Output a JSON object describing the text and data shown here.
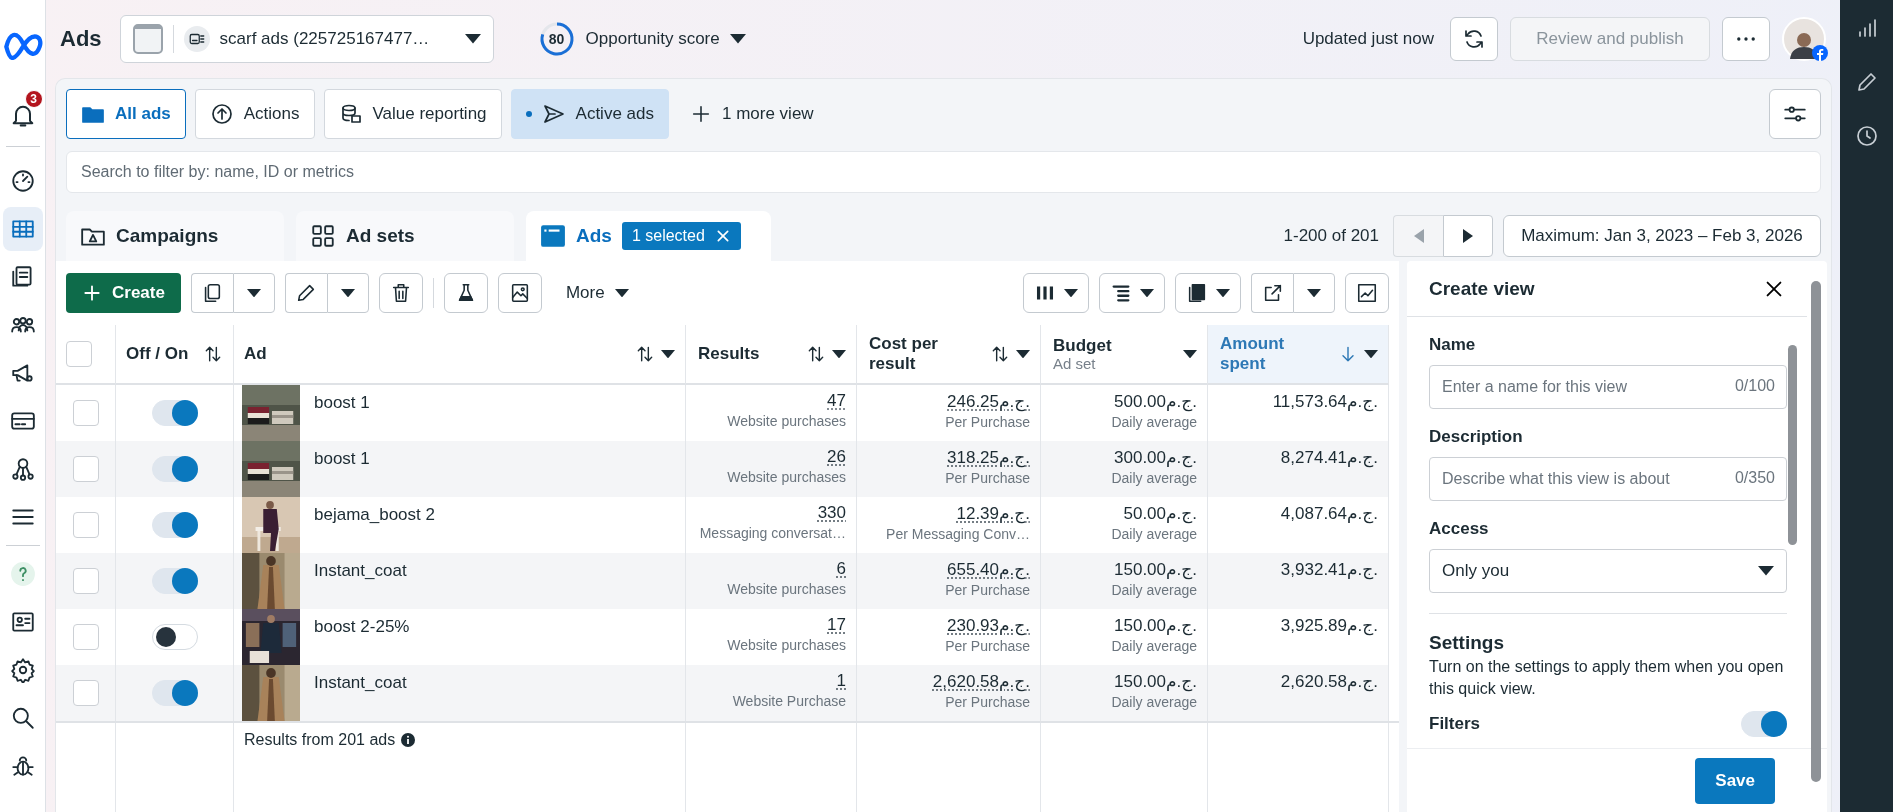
{
  "header": {
    "title": "Ads",
    "account": "scarf ads (225725167477…",
    "score": {
      "value": "80"
    },
    "score_label": "Opportunity score",
    "updated": "Updated just now",
    "review_button": {
      "label": "Review and publish",
      "disabled": true
    }
  },
  "notifications": "3",
  "nav_items": [
    {
      "selected": false
    },
    {
      "selected": true
    },
    {
      "selected": false
    },
    {
      "selected": false
    },
    {
      "selected": false
    },
    {
      "selected": false
    },
    {
      "selected": false
    },
    {
      "selected": false
    },
    {
      "selected": false
    },
    {
      "selected": false
    },
    {
      "selected": false
    },
    {
      "selected": false
    },
    {
      "selected": false
    }
  ],
  "views": [
    {
      "label": "All ads",
      "selected": true,
      "has_changes": false
    },
    {
      "label": "Actions",
      "selected": false,
      "has_changes": false
    },
    {
      "label": "Value reporting",
      "selected": false,
      "has_changes": false
    },
    {
      "label": "Active ads",
      "selected": false,
      "has_changes": true
    }
  ],
  "more_views": "1 more view",
  "search": {
    "placeholder": "Search to filter by: name, ID or metrics"
  },
  "level_tabs": [
    {
      "label": "Campaigns",
      "selected": false
    },
    {
      "label": "Ad sets",
      "selected": false
    },
    {
      "label": "Ads",
      "selected": true
    }
  ],
  "selection_chip": "1 selected",
  "pagination": {
    "range": "1-200 of 201",
    "prev_disabled": true
  },
  "date_range": "Maximum: Jan 3, 2023 – Feb 3, 2026",
  "toolbar": {
    "create": "Create",
    "more": "More"
  },
  "columns": [
    {
      "label": "Off / On",
      "sortable": true,
      "sorted": false,
      "menu": false
    },
    {
      "label": "Ad",
      "sortable": true,
      "sorted": false,
      "menu": true
    },
    {
      "label": "Results",
      "sortable": true,
      "sorted": false,
      "menu": true
    },
    {
      "label": "Cost per result",
      "sortable": true,
      "sorted": false,
      "menu": true
    },
    {
      "label": "Budget",
      "sublabel": "Ad set",
      "sortable": false,
      "sorted": false,
      "menu": true
    },
    {
      "label": "Amount spent",
      "sortable": true,
      "sorted": true,
      "menu": true
    }
  ],
  "select_all": {
    "checked": false
  },
  "rows": [
    {
      "checked": false,
      "on": true,
      "name": "boost 1",
      "results": "47",
      "results_label": "Website purchases",
      "cost": "246.25ج.م.",
      "cost_label": "Per Purchase",
      "budget": "500.00ج.م.",
      "budget_label": "Daily average",
      "spent": "11,573.64ج.م."
    },
    {
      "checked": false,
      "on": true,
      "name": "boost 1",
      "results": "26",
      "results_label": "Website purchases",
      "cost": "318.25ج.م.",
      "cost_label": "Per Purchase",
      "budget": "300.00ج.م.",
      "budget_label": "Daily average",
      "spent": "8,274.41ج.م."
    },
    {
      "checked": false,
      "on": true,
      "name": "bejama_boost 2",
      "results": "330",
      "results_label": "Messaging conversat…",
      "cost": "12.39ج.م.",
      "cost_label": "Per Messaging Conv…",
      "budget": "50.00ج.م.",
      "budget_label": "Daily average",
      "spent": "4,087.64ج.م."
    },
    {
      "checked": false,
      "on": true,
      "name": "Instant_coat",
      "results": "6",
      "results_label": "Website purchases",
      "cost": "655.40ج.م.",
      "cost_label": "Per Purchase",
      "budget": "150.00ج.م.",
      "budget_label": "Daily average",
      "spent": "3,932.41ج.م."
    },
    {
      "checked": false,
      "on": false,
      "name": "boost 2-25%",
      "results": "17",
      "results_label": "Website purchases",
      "cost": "230.93ج.م.",
      "cost_label": "Per Purchase",
      "budget": "150.00ج.م.",
      "budget_label": "Daily average",
      "spent": "3,925.89ج.م."
    },
    {
      "checked": false,
      "on": true,
      "name": "Instant_coat",
      "results": "1",
      "results_label": "Website Purchase",
      "cost": "2,620.58ج.م.",
      "cost_label": "Per Purchase",
      "budget": "150.00ج.م.",
      "budget_label": "Daily average",
      "spent": "2,620.58ج.م."
    }
  ],
  "footer": "Results from 201 ads",
  "create_view": {
    "title": "Create view",
    "name_label": "Name",
    "name_placeholder": "Enter a name for this view",
    "name_count": "0/100",
    "description_label": "Description",
    "description_placeholder": "Describe what this view is about",
    "description_count": "0/350",
    "access_label": "Access",
    "access_value": "Only you",
    "settings_title": "Settings",
    "settings_text": "Turn on the settings to apply them when you open this quick view.",
    "filters": {
      "label": "Filters",
      "on": true
    },
    "save": "Save"
  }
}
